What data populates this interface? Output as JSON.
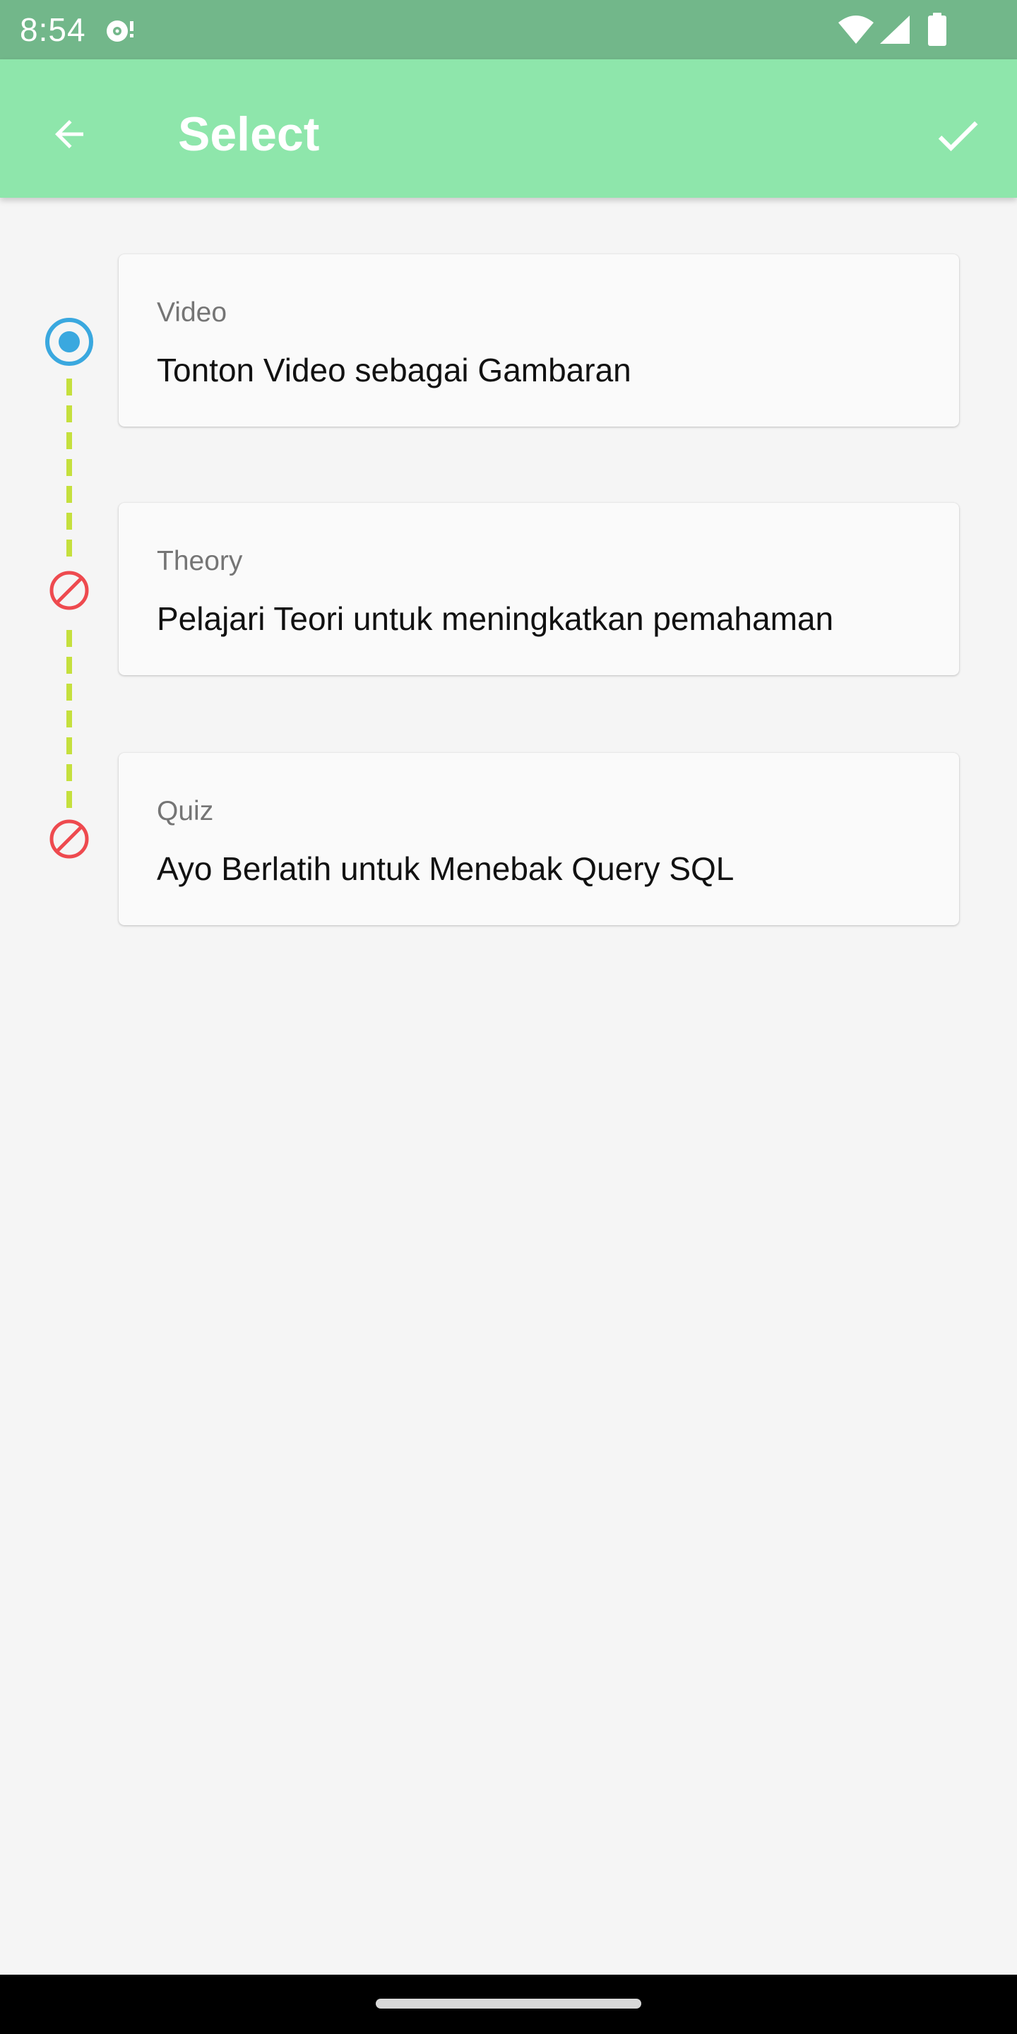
{
  "status_bar": {
    "time": "8:54",
    "icons": [
      "notification-icon",
      "wifi-icon",
      "cell-signal-icon",
      "battery-icon"
    ]
  },
  "app_bar": {
    "title": "Select",
    "back_icon": "arrow-back-icon",
    "confirm_icon": "check-icon",
    "background_color": "#8ee6ab"
  },
  "steps": [
    {
      "label": "Video",
      "description": "Tonton Video sebagai Gambaran",
      "state": "selected",
      "marker_icon": "radio-selected-icon",
      "marker_color": "#3aa8df"
    },
    {
      "label": "Theory",
      "description": "Pelajari Teori untuk meningkatkan pemahaman",
      "state": "locked",
      "marker_icon": "blocked-icon",
      "marker_color": "#ee4a4f"
    },
    {
      "label": "Quiz",
      "description": "Ayo Berlatih untuk Menebak Query SQL",
      "state": "locked",
      "marker_icon": "blocked-icon",
      "marker_color": "#ee4a4f"
    }
  ],
  "timeline": {
    "line_color": "#c5e03d"
  }
}
